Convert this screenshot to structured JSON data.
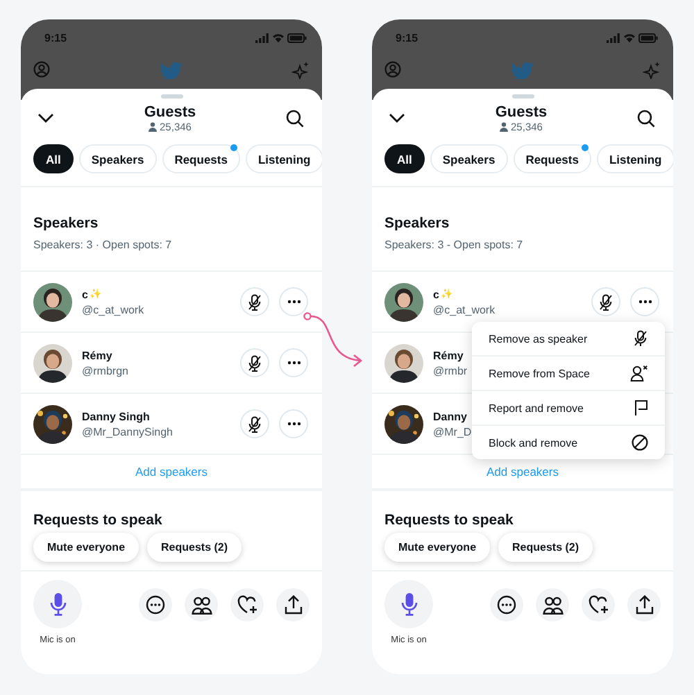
{
  "screens": [
    {
      "status_bar": {
        "time": "9:15"
      },
      "sheet": {
        "title": "Guests",
        "listener_count": "25,346"
      },
      "tabs": [
        {
          "label": "All",
          "selected": true,
          "has_new": false
        },
        {
          "label": "Speakers",
          "selected": false,
          "has_new": false
        },
        {
          "label": "Requests",
          "selected": false,
          "has_new": true
        },
        {
          "label": "Listening",
          "selected": false,
          "has_new": false
        }
      ],
      "speakers_section": {
        "title": "Speakers",
        "summary": "Speakers: 3 · Open spots: 7"
      },
      "speakers": [
        {
          "name": "c",
          "badge": "✨",
          "handle": "@c_at_work",
          "muted": true,
          "actions": true
        },
        {
          "name": "Rémy",
          "handle": "@rmbrgn",
          "muted": true,
          "actions": true
        },
        {
          "name": "Danny Singh",
          "handle": "@Mr_DannySingh",
          "muted": true,
          "actions": true
        }
      ],
      "add_speakers": "Add speakers",
      "requests_section": {
        "title": "Requests to speak"
      },
      "floating_buttons": [
        "Mute everyone",
        "Requests (2)"
      ],
      "mic": {
        "on": true,
        "label": "Mic is on"
      }
    },
    {
      "status_bar": {
        "time": "9:15"
      },
      "sheet": {
        "title": "Guests",
        "listener_count": "25,346"
      },
      "tabs": [
        {
          "label": "All",
          "selected": true,
          "has_new": false
        },
        {
          "label": "Speakers",
          "selected": false,
          "has_new": false
        },
        {
          "label": "Requests",
          "selected": false,
          "has_new": true
        },
        {
          "label": "Listening",
          "selected": false,
          "has_new": false
        }
      ],
      "speakers_section": {
        "title": "Speakers",
        "summary": "Speakers: 3 - Open spots: 7"
      },
      "speakers": [
        {
          "name": "c",
          "badge": "✨",
          "handle": "@c_at_work",
          "muted": true,
          "actions": true
        },
        {
          "name": "Rémy",
          "handle": "@rmbr",
          "actions": false
        },
        {
          "name": "Danny",
          "handle": "@Mr_D",
          "actions": false
        }
      ],
      "add_speakers": "Add speakers",
      "requests_section": {
        "title": "Requests to speak"
      },
      "floating_buttons": [
        "Mute everyone",
        "Requests (2)"
      ],
      "mic": {
        "on": true,
        "label": "Mic is on"
      },
      "menu": [
        {
          "label": "Remove as speaker",
          "kind": "mic-off"
        },
        {
          "label": "Remove from Space",
          "kind": "person-remove"
        },
        {
          "label": "Report and remove",
          "kind": "flag"
        },
        {
          "label": "Block and remove",
          "kind": "block"
        }
      ]
    }
  ]
}
